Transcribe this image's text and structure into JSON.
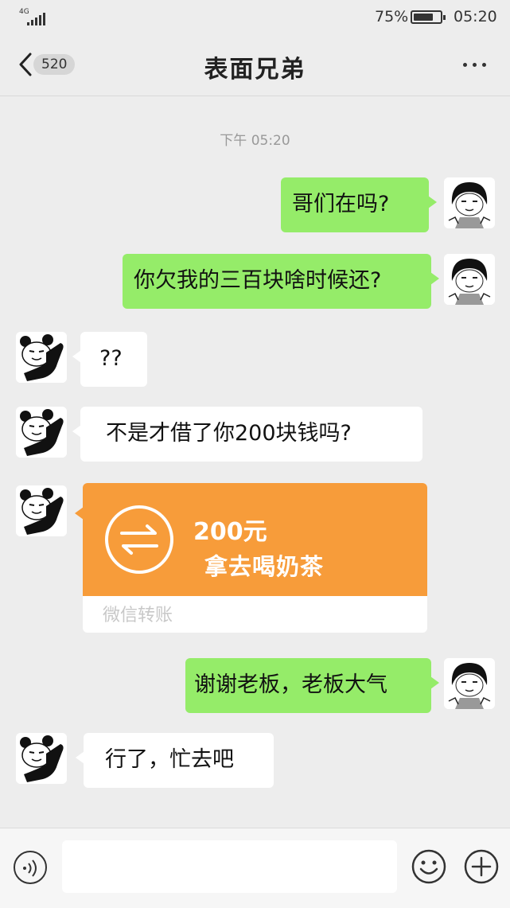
{
  "status": {
    "network": "4G",
    "battery": "75%",
    "battery_level": 0.75,
    "time": "05:20"
  },
  "header": {
    "unread_count": "520",
    "title": "表面兄弟"
  },
  "chat": {
    "timestamp": "下午 05:20",
    "messages": [
      {
        "side": "out",
        "text": "哥们在吗?"
      },
      {
        "side": "out",
        "text": "你欠我的三百块啥时候还?"
      },
      {
        "side": "in",
        "text": "??"
      },
      {
        "side": "in",
        "text": "不是才借了你200块钱吗?"
      },
      {
        "side": "in",
        "type": "transfer",
        "amount": "200元",
        "note": "拿去喝奶茶",
        "footer": "微信转账"
      },
      {
        "side": "out",
        "text": "谢谢老板，老板大气"
      },
      {
        "side": "in",
        "text": "行了，忙去吧"
      }
    ]
  },
  "input_bar": {
    "placeholder": ""
  },
  "icons": {
    "back": "chevron-left-icon",
    "more": "more-dots-icon",
    "voice": "voice-icon",
    "emoji": "emoji-icon",
    "plus": "plus-icon",
    "transfer": "transfer-arrows-icon"
  },
  "colors": {
    "out_bubble": "#95ec69",
    "in_bubble": "#ffffff",
    "transfer": "#f79c3a",
    "background": "#ededed"
  }
}
